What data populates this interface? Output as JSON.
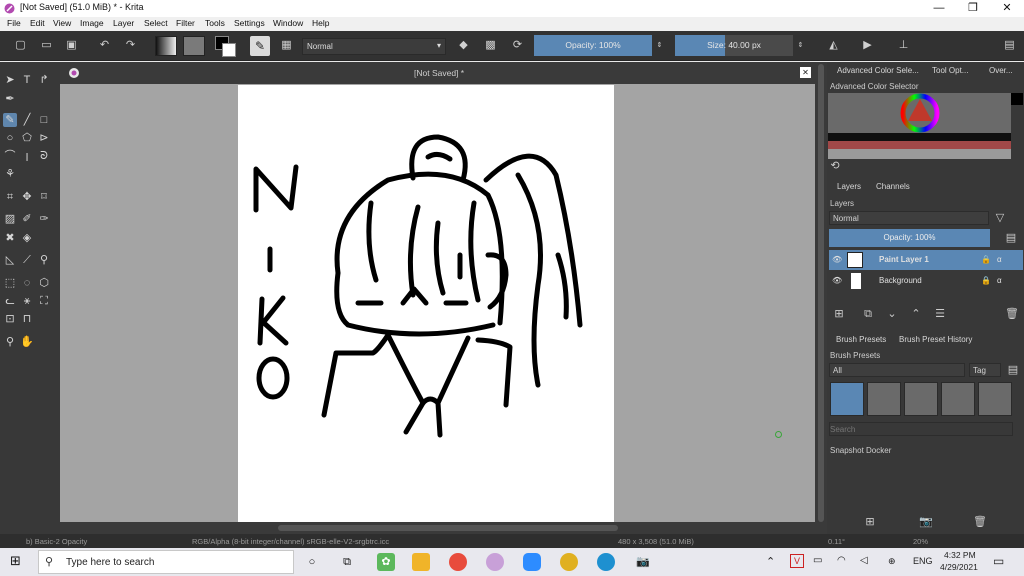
{
  "window": {
    "title": "[Not Saved]  (51.0 MiB)  * - Krita",
    "minimize": "—",
    "restore": "❐",
    "close": "✕"
  },
  "menu": [
    "File",
    "Edit",
    "View",
    "Image",
    "Layer",
    "Select",
    "Filter",
    "Tools",
    "Settings",
    "Window",
    "Help"
  ],
  "toolbar": {
    "blend_mode": "Normal",
    "opacity": "Opacity: 100%",
    "opacity_value": 1.0,
    "size": "Size: 40.00 px"
  },
  "document": {
    "tab_title": "[Not Saved]  *",
    "drawing_text": "NIKO"
  },
  "dock": {
    "top_tabs": [
      "Advanced Color Sele...",
      "Tool Opt...",
      "Over..."
    ],
    "color_selector_title": "Advanced Color Selector",
    "layer_tabs": [
      "Layers",
      "Channels"
    ],
    "layers_title": "Layers",
    "blend_mode": "Normal",
    "opacity": "Opacity:  100%",
    "layers": [
      {
        "name": "Paint Layer 1",
        "selected": true
      },
      {
        "name": "Background",
        "selected": false
      }
    ],
    "brush_tabs": [
      "Brush Presets",
      "Brush Preset History"
    ],
    "brush_title": "Brush Presets",
    "brush_filter": "All",
    "brush_tag": "Tag",
    "brush_search_placeholder": "Search",
    "snapshot_title": "Snapshot Docker"
  },
  "status": {
    "preset": "b) Basic-2 Opacity",
    "color_info": "RGB/Alpha (8-bit integer/channel)  sRGB-elle-V2-srgbtrc.icc",
    "image_size": "480 x 3,508 (51.0 MiB)",
    "rotation": "0.11°",
    "zoom": "20%"
  },
  "taskbar": {
    "search_placeholder": "Type here to search",
    "language": "ENG",
    "time": "4:32 PM",
    "date": "4/29/2021"
  },
  "colors": {
    "accent": "#5a87b4",
    "panel": "#383838",
    "canvas_bg": "#a4a4a4"
  }
}
